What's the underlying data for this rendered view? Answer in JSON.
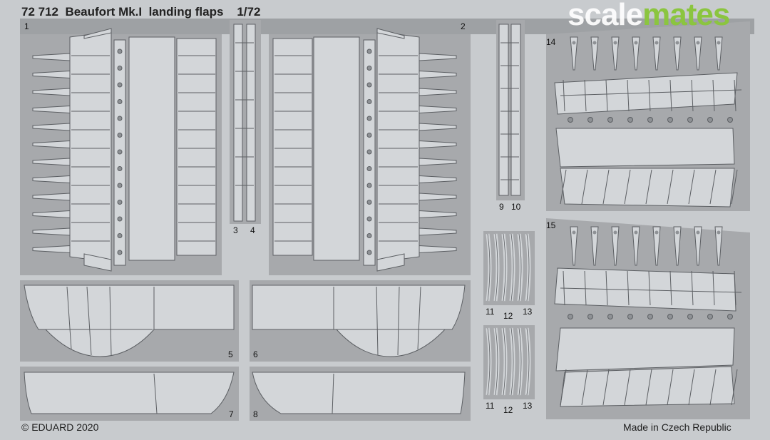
{
  "header": {
    "product_number": "72 712",
    "product_name": "Beaufort Mk.I  landing flaps",
    "scale": "1/72"
  },
  "footer": {
    "copyright": "© EDUARD 2020",
    "origin": "Made in Czech Republic"
  },
  "watermark": {
    "brand_part1": "scale",
    "brand_part2": "mates",
    "color_part1": "#ffffff",
    "color_part2": "#8bc53f"
  },
  "part_numbers": {
    "p1": "1",
    "p2": "2",
    "p3": "3",
    "p4": "4",
    "p5": "5",
    "p6": "6",
    "p7": "7",
    "p8": "8",
    "p9": "9",
    "p10": "10",
    "p11a": "11",
    "p12a": "12",
    "p13a": "13",
    "p11b": "11",
    "p12b": "12",
    "p13b": "13",
    "p14": "14",
    "p15": "15"
  },
  "colors": {
    "sheet": "#c8cbce",
    "panel": "#a7a9ac",
    "part": "#d3d6d9",
    "line": "#5c5f63"
  }
}
